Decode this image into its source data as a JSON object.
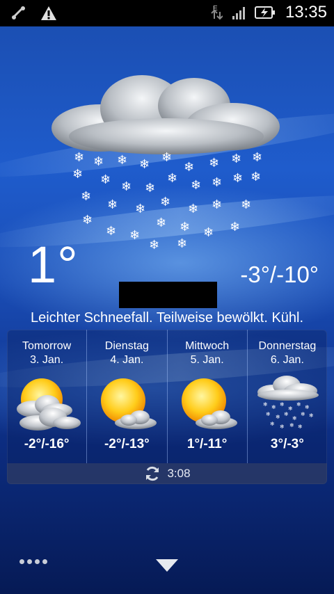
{
  "status_bar": {
    "time": "13:35",
    "network_label": "E",
    "icons": [
      "usb-debug-icon",
      "warning-icon",
      "network-e-icon",
      "signal-icon",
      "battery-charging-icon"
    ]
  },
  "current": {
    "temperature": "1°",
    "high_low": "-3°/-10°",
    "condition": "Leichter Schneefall. Teilweise bewölkt. Kühl.",
    "icon": "snow-cloud-icon"
  },
  "forecast": [
    {
      "day": "Tomorrow",
      "date": "3. Jan.",
      "temp": "-2°/-16°",
      "icon": "sun-clouds-icon"
    },
    {
      "day": "Dienstag",
      "date": "4. Jan.",
      "temp": "-2°/-13°",
      "icon": "sun-small-cloud-icon"
    },
    {
      "day": "Mittwoch",
      "date": "5. Jan.",
      "temp": "1°/-11°",
      "icon": "sun-small-cloud-icon"
    },
    {
      "day": "Donnerstag",
      "date": "6. Jan.",
      "temp": "3°/-3°",
      "icon": "snow-cloud-icon"
    }
  ],
  "update": {
    "time": "3:08",
    "icon": "refresh-icon"
  },
  "bottom_bar": {
    "icons": [
      "menu-dots-icon",
      "collapse-down-icon"
    ]
  },
  "colors": {
    "background_top": "#1f5ccc",
    "background_bottom": "#061a55",
    "text": "#ffffff"
  }
}
